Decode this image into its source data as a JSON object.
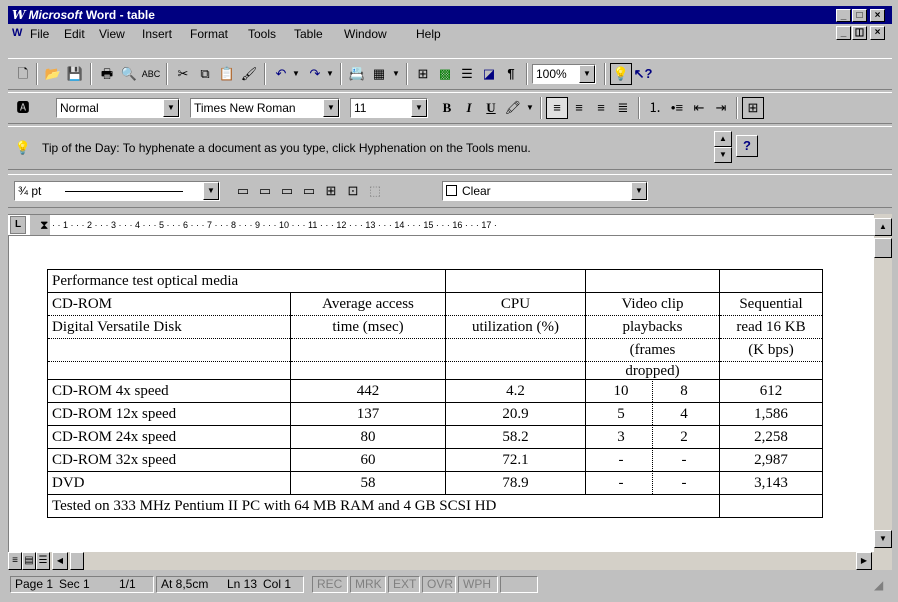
{
  "window": {
    "app": "Microsoft",
    "title": " Word - table"
  },
  "menu": [
    "File",
    "Edit",
    "View",
    "Insert",
    "Format",
    "Tools",
    "Table",
    "Window",
    "Help"
  ],
  "toolbar": {
    "zoom": "100%"
  },
  "format": {
    "style": "Normal",
    "font": "Times New Roman",
    "size": "11",
    "bold": "B",
    "italic": "I",
    "underline": "U"
  },
  "tip": {
    "text": "Tip of the Day: To hyphenate a document as you type, click Hyphenation on the Tools menu.",
    "help": "?"
  },
  "borders": {
    "line_weight": "¾ pt",
    "shading": "Clear"
  },
  "ruler": {
    "marks": "· · 1 · · · 2 · · · 3 · · · 4 · · · 5 · · · 6 · · · 7 · · · 8 · · · 9 · · · 10 · · · 11 · · · 12 · · · 13 · · · 14 · · · 15 · · · 16 · · · 17 ·"
  },
  "table": {
    "title": "Performance test optical media",
    "headers1": [
      "CD-ROM",
      "Average access",
      "CPU",
      "Video clip",
      "Sequential"
    ],
    "headers2": [
      "Digital Versatile Disk",
      "time (msec)",
      "utilization (%)",
      "playbacks",
      "read 16 KB"
    ],
    "headers3": [
      "",
      "",
      "",
      "(frames",
      "(K bps)"
    ],
    "headers4": [
      "",
      "",
      "",
      "dropped)",
      ""
    ],
    "rows": [
      [
        "CD-ROM 4x speed",
        "442",
        "4.2",
        "10",
        "8",
        "612"
      ],
      [
        "CD-ROM 12x speed",
        "137",
        "20.9",
        "5",
        "4",
        "1,586"
      ],
      [
        "CD-ROM 24x speed",
        "80",
        "58.2",
        "3",
        "2",
        "2,258"
      ],
      [
        "CD-ROM 32x speed",
        "60",
        "72.1",
        "-",
        "-",
        "2,987"
      ],
      [
        "DVD",
        "58",
        "78.9",
        "-",
        "-",
        "3,143"
      ]
    ],
    "footer": "Tested on 333 MHz Pentium II PC with 64 MB RAM and 4 GB SCSI HD"
  },
  "status": {
    "page": "Page 1",
    "sec": "Sec 1",
    "pages": "1/1",
    "at": "At 8,5cm",
    "ln": "Ln 13",
    "col": "Col 1",
    "rec": "REC",
    "mrk": "MRK",
    "ext": "EXT",
    "ovr": "OVR",
    "wph": "WPH"
  }
}
